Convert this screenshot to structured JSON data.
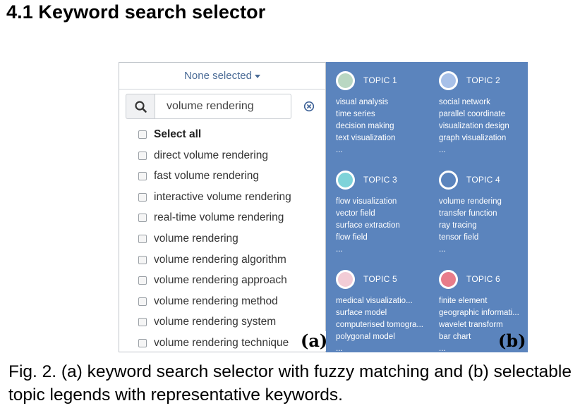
{
  "section_title": "4.1 Keyword search selector",
  "selector": {
    "button_label": "None selected",
    "search_value": "volume rendering",
    "select_all_label": "Select all",
    "options": [
      "direct volume rendering",
      "fast volume rendering",
      "interactive volume rendering",
      "real-time volume rendering",
      "volume rendering",
      "volume rendering algorithm",
      "volume rendering approach",
      "volume rendering method",
      "volume rendering system",
      "volume rendering technique"
    ],
    "panel_label": "(a)"
  },
  "topics_panel": {
    "background": "#5b84bd",
    "panel_label": "(b)",
    "topics": [
      {
        "name": "TOPIC 1",
        "color": "#b9d7c2",
        "keywords": [
          "visual analysis",
          "time series",
          "decision making",
          "text visualization",
          "..."
        ]
      },
      {
        "name": "TOPIC 2",
        "color": "#a7c0e8",
        "keywords": [
          "social network",
          "parallel coordinate",
          "visualization design",
          "graph visualization",
          "..."
        ]
      },
      {
        "name": "TOPIC 3",
        "color": "#7ed3d9",
        "keywords": [
          "flow visualization",
          "vector field",
          "surface extraction",
          "flow field",
          "..."
        ]
      },
      {
        "name": "TOPIC 4",
        "color": "#5b84bd",
        "keywords": [
          "volume rendering",
          "transfer function",
          "ray tracing",
          "tensor field",
          "..."
        ]
      },
      {
        "name": "TOPIC 5",
        "color": "#f2ccd6",
        "keywords": [
          "medical visualizatio...",
          "surface model",
          "computerised tomogra...",
          "polygonal model",
          "..."
        ]
      },
      {
        "name": "TOPIC 6",
        "color": "#e87c8a",
        "keywords": [
          "finite element",
          "geographic informati...",
          "wavelet transform",
          "bar chart",
          "..."
        ]
      }
    ]
  },
  "caption": "Fig. 2. (a) keyword search selector with fuzzy matching and (b) selectable topic legends with representative keywords."
}
